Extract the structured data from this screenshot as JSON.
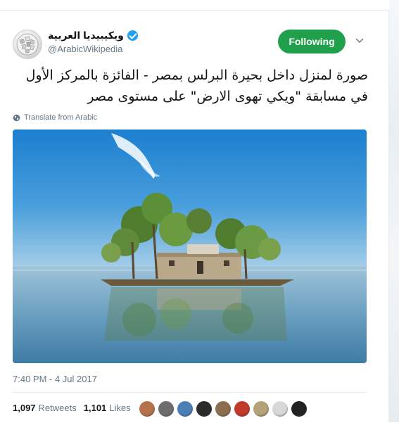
{
  "account": {
    "display_name": "ويكيبيديا العربية",
    "handle": "@ArabicWikipedia",
    "verified": true,
    "avatar_icon": "wikipedia-globe-icon"
  },
  "follow_button": {
    "label": "Following",
    "color": "#21a04b"
  },
  "more_menu_icon": "chevron-down-icon",
  "tweet": {
    "text": "صورة لمنزل داخل بحيرة البرلس بمصر - الفائزة بالمركز الأول في مسابقة \"ويكي تهوى الارض\" على مستوى مصر",
    "translate_label": "Translate from Arabic",
    "timestamp": "7:40 PM - 4 Jul 2017"
  },
  "photo": {
    "subject": "house-on-island-photo"
  },
  "stats": {
    "retweets_count": "1,097",
    "retweets_label": "Retweets",
    "likes_count": "1,101",
    "likes_label": "Likes",
    "liker_avatar_colors": [
      "#b5714a",
      "#6d6d6d",
      "#4a7fb5",
      "#2b2b2b",
      "#8a6e4f",
      "#c0392b",
      "#b4a27a",
      "#d8d8d8",
      "#222222"
    ]
  }
}
